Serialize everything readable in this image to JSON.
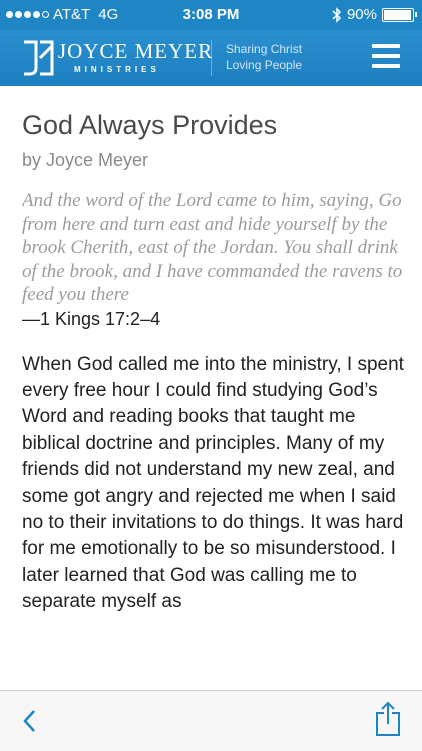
{
  "status_bar": {
    "carrier": "AT&T",
    "network": "4G",
    "time": "3:08 PM",
    "battery_percent": "90%",
    "battery_level": 0.9,
    "icons": [
      "signal-dots-icon",
      "bluetooth-icon",
      "battery-icon"
    ]
  },
  "header": {
    "brand_name": "JOYCE MEYER",
    "brand_sub": "MINISTRIES",
    "tagline_line1": "Sharing Christ",
    "tagline_line2": "Loving People",
    "menu_icon": "hamburger-menu-icon",
    "color": "#1f86c6"
  },
  "article": {
    "title": "God Always Provides",
    "byline": "by Joyce Meyer",
    "quote": "And the word of the Lord came to him, saying, Go from here and turn east and hide yourself by the brook Cherith, east of the Jordan. You shall drink of the brook, and I have commanded the ravens to feed you there",
    "reference": "—1 Kings 17:2–4",
    "body": "When God called me into the ministry, I spent every free hour I could find studying God’s Word and reading books that taught me biblical doctrine and principles. Many of my friends did not understand my new zeal, and some got angry and rejected me when I said no to their invitations to do things. It was hard for me emotionally to be so misunderstood. I later learned that God was calling me to separate myself as"
  },
  "toolbar": {
    "back_icon": "back-chevron-icon",
    "share_icon": "share-icon",
    "accent": "#1f86c6"
  }
}
